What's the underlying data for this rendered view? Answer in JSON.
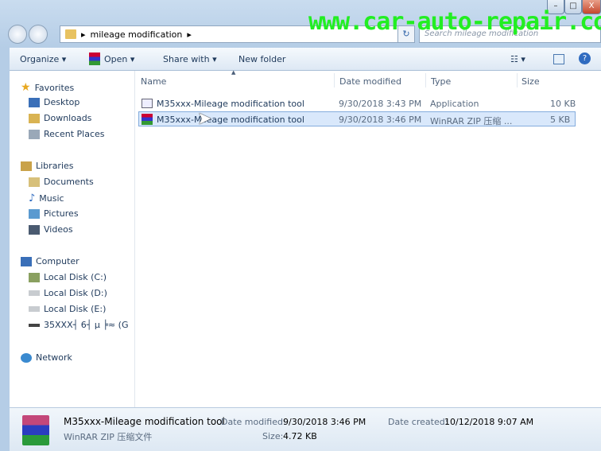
{
  "watermark": "www.car-auto-repair.com",
  "window": {
    "minimize": "–",
    "maximize": "□",
    "close": "X"
  },
  "address": {
    "path": "mileage modification",
    "search_placeholder": "Search mileage modification"
  },
  "toolbar": {
    "organize": "Organize ▾",
    "open": "Open ▾",
    "share": "Share with ▾",
    "new_folder": "New folder"
  },
  "sidebar": {
    "favorites": "Favorites",
    "desktop": "Desktop",
    "downloads": "Downloads",
    "recent": "Recent Places",
    "libraries": "Libraries",
    "documents": "Documents",
    "music": "Music",
    "pictures": "Pictures",
    "videos": "Videos",
    "computer": "Computer",
    "c": "Local Disk (C:)",
    "d": "Local Disk (D:)",
    "e": "Local Disk (E:)",
    "g": "35XXX┤ 6┤ µ ╞≈ (G",
    "network": "Network"
  },
  "columns": {
    "name": "Name",
    "date": "Date modified",
    "type": "Type",
    "size": "Size"
  },
  "files": [
    {
      "name": "M35xxx-Mileage modification tool",
      "date": "9/30/2018 3:43 PM",
      "type": "Application",
      "size": "10 KB"
    },
    {
      "name": "M35xxx-Mileage modification tool",
      "date": "9/30/2018 3:46 PM",
      "type": "WinRAR ZIP 压缩 ...",
      "size": "5 KB"
    }
  ],
  "details": {
    "name": "M35xxx-Mileage modification tool",
    "type": "WinRAR ZIP 压缩文件",
    "modified_label": "Date modified:",
    "modified": "9/30/2018 3:46 PM",
    "created_label": "Date created:",
    "created": "10/12/2018 9:07 AM",
    "size_label": "Size:",
    "size": "4.72 KB"
  }
}
